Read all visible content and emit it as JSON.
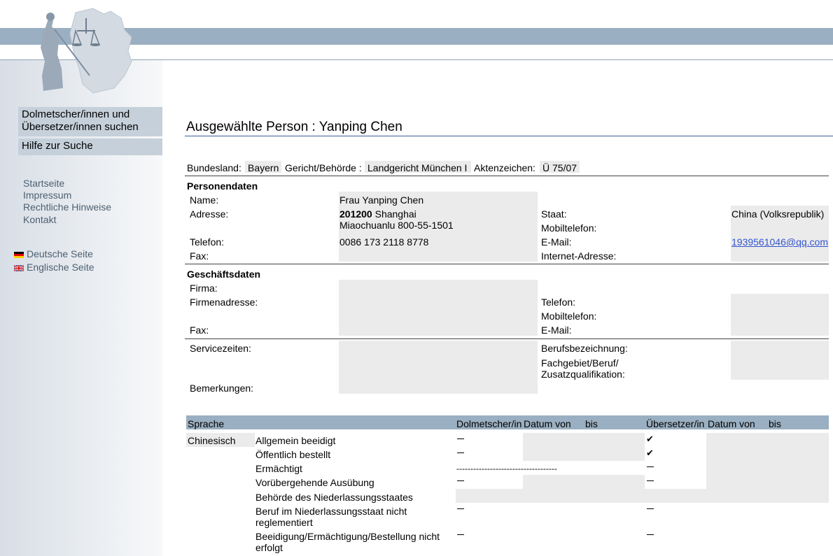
{
  "nav": {
    "search_label_line1": "Dolmetscher/innen und",
    "search_label_line2": "Übersetzer/innen suchen",
    "help_label": "Hilfe zur Suche",
    "links": [
      "Startseite",
      "Impressum",
      "Rechtliche Hinweise",
      "Kontakt"
    ],
    "lang_de": "Deutsche Seite",
    "lang_en": "Englische Seite"
  },
  "page": {
    "title": "Ausgewählte Person : Yanping Chen"
  },
  "header_row": {
    "bundesland_label": "Bundesland:",
    "bundesland_value": "Bayern",
    "gericht_label": "Gericht/Behörde :",
    "gericht_value": "Landgericht München I",
    "aktenzeichen_label": "Aktenzeichen:",
    "aktenzeichen_value": "Ü 75/07"
  },
  "personendaten": {
    "heading": "Personendaten",
    "name_label": "Name:",
    "name_value": "Frau Yanping Chen",
    "adresse_label": "Adresse:",
    "adresse_plz": "201200",
    "adresse_city": " Shanghai",
    "adresse_street": "Miaochuanlu 800-55-1501",
    "telefon_label": "Telefon:",
    "telefon_value": "0086 173 2118 8778",
    "fax_label": "Fax:",
    "staat_label": "Staat:",
    "staat_value": "China (Volksrepublik)",
    "mobil_label": "Mobiltelefon:",
    "email_label": "E-Mail:",
    "email_value": "1939561046@qq.com",
    "internet_label": "Internet-Adresse:"
  },
  "geschaeftsdaten": {
    "heading": "Geschäftsdaten",
    "firma_label": "Firma:",
    "firmenadresse_label": "Firmenadresse:",
    "fax_label": "Fax:",
    "telefon_label": "Telefon:",
    "mobil_label": "Mobiltelefon:",
    "email_label": "E-Mail:",
    "service_label": "Servicezeiten:",
    "bemerkungen_label": "Bemerkungen:",
    "beruf_label": "Berufsbezeichnung:",
    "fachgebiet_line1": "Fachgebiet/Beruf/",
    "fachgebiet_line2": "Zusatzqualifikation:"
  },
  "sprache": {
    "col_sprache": "Sprache",
    "col_dolmetscher": "Dolmetscher/in",
    "col_datum_von_1": "Datum von",
    "col_bis_1": "bis",
    "col_uebersetzer": "Übersetzer/in",
    "col_datum_von_2": "Datum von",
    "col_bis_2": "bis",
    "language": "Chinesisch",
    "rows": [
      "Allgemein beeidigt",
      "Öffentlich bestellt",
      "Ermächtigt",
      "Vorübergehende Ausübung",
      "Behörde des Niederlassungsstaates",
      "Beruf im Niederlassungsstaat nicht",
      "reglementiert",
      "Beeidigung/Ermächtigung/Bestellung nicht",
      "erfolgt"
    ],
    "ermaechtigt_dashes": "------------------------------------",
    "check_symbol": "✔"
  },
  "colors": {
    "accent": "#9aafc1",
    "navbox": "#c5d0da",
    "field": "#ebebeb"
  },
  "icons": {
    "logo": "justitia-germany-logo",
    "flag_de": "german-flag-icon",
    "flag_en": "uk-flag-icon"
  }
}
